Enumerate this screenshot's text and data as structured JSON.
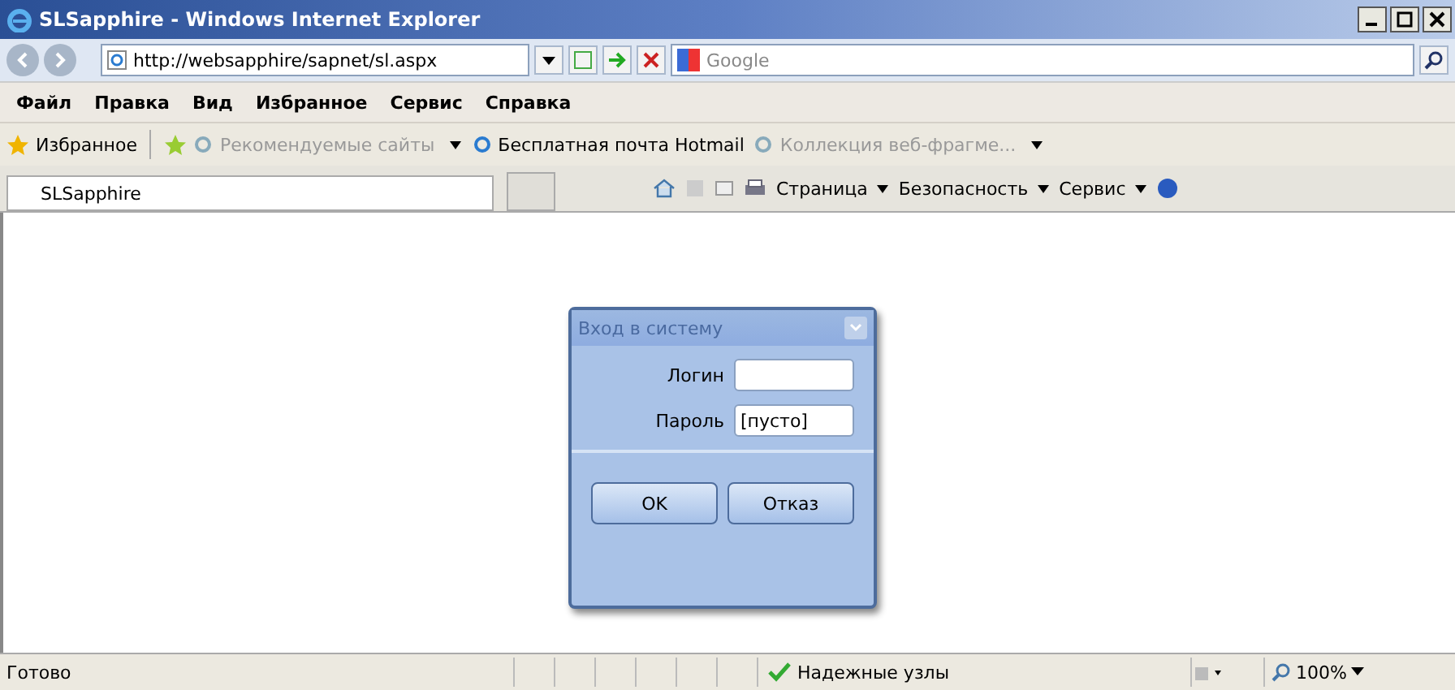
{
  "window": {
    "title": "SLSapphire - Windows Internet Explorer"
  },
  "address": {
    "url": "http://websapphire/sapnet/sl.aspx"
  },
  "search": {
    "placeholder": "Google"
  },
  "menu": [
    "Файл",
    "Правка",
    "Вид",
    "Избранное",
    "Сервис",
    "Справка"
  ],
  "favorites_bar": {
    "label": "Избранное",
    "links": [
      {
        "label": "Рекомендуемые сайты",
        "dimmed": true,
        "dropdown": true
      },
      {
        "label": "Бесплатная почта Hotmail",
        "dimmed": false,
        "dropdown": false
      },
      {
        "label": "Коллекция веб-фрагме...",
        "dimmed": true,
        "dropdown": true
      }
    ]
  },
  "tab": {
    "title": "SLSapphire"
  },
  "command_bar": [
    "Страница",
    "Безопасность",
    "Сервис"
  ],
  "dialog": {
    "title": "Вход в систему",
    "fields": [
      {
        "label": "Логин"
      },
      {
        "label": "Пароль",
        "value": "[пусто]"
      }
    ],
    "buttons": [
      "OK",
      "Отказ"
    ]
  },
  "status_bar": {
    "text": "Готово",
    "zone": "Надежные узлы",
    "zoom": "100%"
  }
}
